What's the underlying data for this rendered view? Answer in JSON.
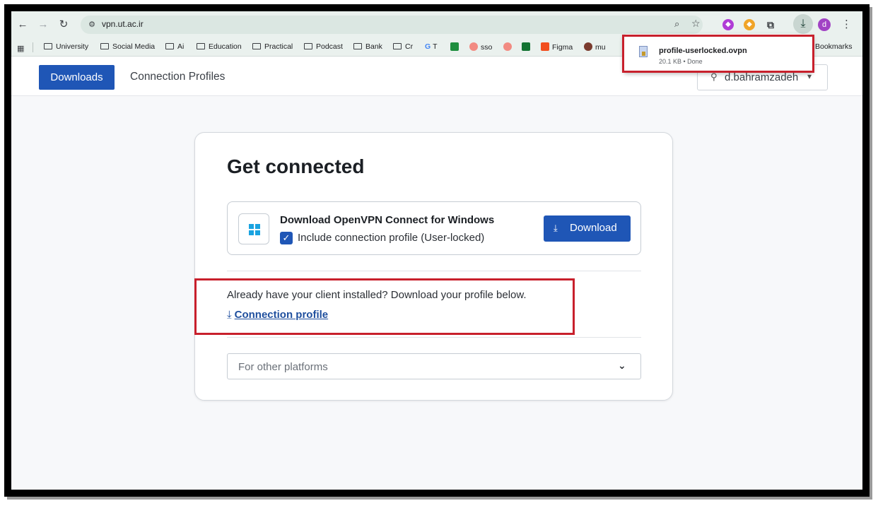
{
  "browser": {
    "url": "vpn.ut.ac.ir",
    "avatar_letter": "d",
    "bookmarks": [
      "University",
      "Social Media",
      "Ai",
      "Education",
      "Practical",
      "Podcast",
      "Bank",
      "Cr"
    ],
    "bookmarks_extra": [
      "T",
      "sso",
      "Figma",
      "mu"
    ],
    "all_bookmarks_label": "Bookmarks"
  },
  "download_popup": {
    "filename": "profile-userlocked.ovpn",
    "meta": "20.1 KB • Done"
  },
  "header": {
    "tab_downloads": "Downloads",
    "tab_profiles": "Connection Profiles",
    "username": "d.bahramzadeh"
  },
  "card": {
    "title": "Get connected",
    "download_heading": "Download OpenVPN Connect for Windows",
    "include_profile_label": "Include connection profile (User-locked)",
    "download_button": "Download",
    "already_text": "Already have your client installed? Download your profile below.",
    "connection_profile_link": "Connection profile",
    "other_platforms": "For other platforms"
  },
  "colors": {
    "primary": "#1f56b6",
    "highlight": "#c8202c"
  }
}
